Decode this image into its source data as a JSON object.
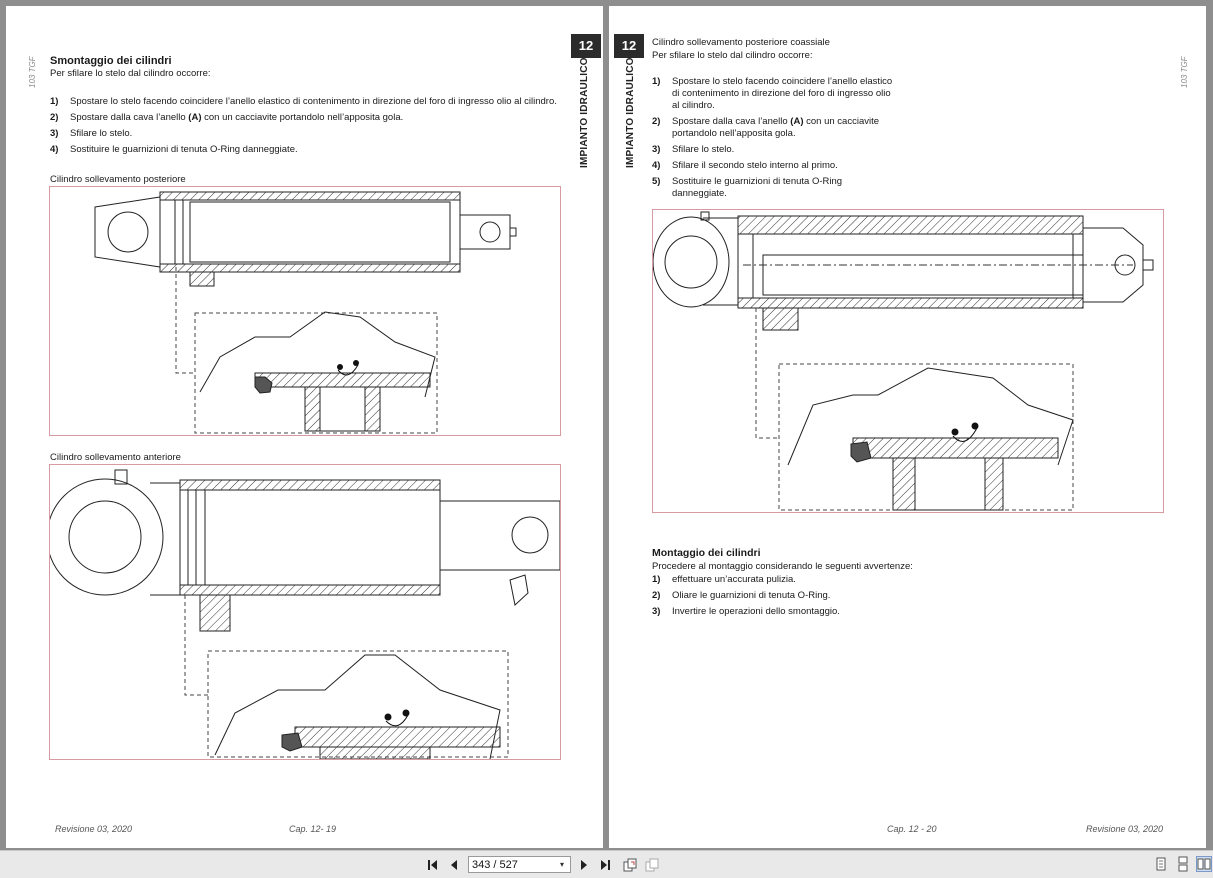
{
  "left_page": {
    "side_code": "103 TGF",
    "chapter_number": "12",
    "chapter_title": "IMPIANTO IDRAULICO",
    "heading": "Smontaggio dei cilindri",
    "intro": "Per sfilare lo stelo dal cilindro occorre:",
    "steps": [
      {
        "num": "1)",
        "text": "Spostare lo stelo facendo coincidere l’anello elastico di contenimento in direzione del foro di ingresso olio al cilindro."
      },
      {
        "num": "2)",
        "text_before": "Spostare dalla cava l’anello ",
        "bold": "(A)",
        "text_after": " con un cacciavite portandolo nell’apposita gola."
      },
      {
        "num": "3)",
        "text": "Sfilare lo stelo."
      },
      {
        "num": "4)",
        "text": "Sostituire le guarnizioni di tenuta O-Ring danneggiate."
      }
    ],
    "figure1_caption": "Cilindro sollevamento posteriore",
    "figure2_caption": "Cilindro sollevamento anteriore",
    "footer_left": "Revisione 03, 2020",
    "footer_center": "Cap. 12- 19"
  },
  "right_page": {
    "side_code": "103 TGF",
    "chapter_number": "12",
    "chapter_title": "IMPIANTO IDRAULICO",
    "heading_line1": "Cilindro sollevamento posteriore coassiale",
    "intro": "Per sfilare lo stelo dal cilindro occorre:",
    "steps": [
      {
        "num": "1)",
        "text": "Spostare lo stelo facendo coincidere l’anello elastico di contenimento in direzione del foro di ingresso olio al cilindro."
      },
      {
        "num": "2)",
        "text_before": "Spostare dalla cava l’anello ",
        "bold": "(A)",
        "text_after": " con un cacciavite portandolo nell’apposita gola."
      },
      {
        "num": "3)",
        "text": "Sfilare lo stelo."
      },
      {
        "num": "4)",
        "text": "Sfilare il secondo stelo interno al primo."
      },
      {
        "num": "5)",
        "text": "Sostituire le guarnizioni di tenuta O-Ring danneggiate."
      }
    ],
    "assembly_heading": "Montaggio dei cilindri",
    "assembly_intro": "Procedere al montaggio considerando le seguenti avvertenze:",
    "assembly_steps": [
      {
        "num": "1)",
        "text": "effettuare un’accurata pulizia."
      },
      {
        "num": "2)",
        "text": "Oliare le guarnizioni di tenuta O-Ring."
      },
      {
        "num": "3)",
        "text": "Invertire le operazioni dello smontaggio."
      }
    ],
    "footer_center": "Cap. 12 - 20",
    "footer_right": "Revisione 03, 2020"
  },
  "toolbar": {
    "first_icon": "first-page-icon",
    "prev_icon": "previous-page-icon",
    "page_value": "343 / 527",
    "next_icon": "next-page-icon",
    "last_icon": "last-page-icon",
    "rotate_icon": "rotate-icon",
    "fit_icon": "fit-page-icon",
    "view_single_icon": "single-page-view-icon",
    "view_continuous_icon": "continuous-view-icon",
    "view_facing_icon": "facing-pages-view-icon"
  },
  "colors": {
    "figure_border": "#d89aa0",
    "chapter_box": "#2b2b2b",
    "viewer_background": "#8e8e8e"
  }
}
